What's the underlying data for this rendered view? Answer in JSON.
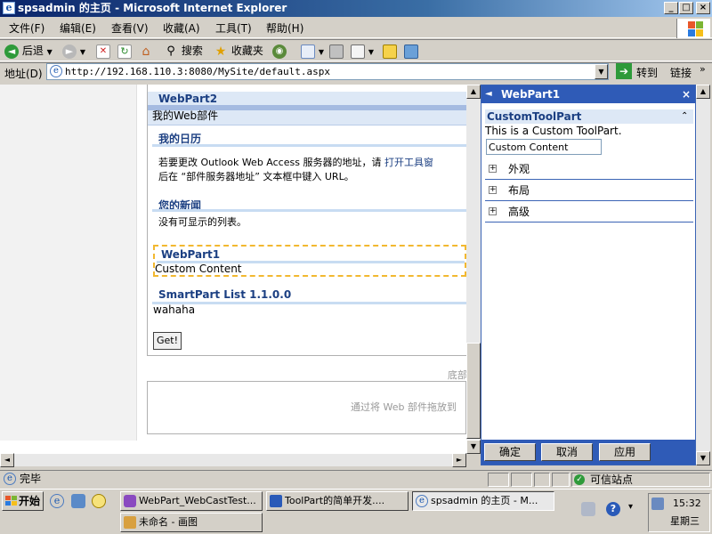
{
  "window": {
    "title": "spsadmin 的主页 - Microsoft Internet Explorer",
    "app_icon_letter": "e",
    "buttons": {
      "min": "_",
      "max": "□",
      "close": "×"
    }
  },
  "menu": [
    "文件(F)",
    "编辑(E)",
    "查看(V)",
    "收藏(A)",
    "工具(T)",
    "帮助(H)"
  ],
  "toolbar": {
    "back": "后退",
    "search": "搜索",
    "favorites": "收藏夹"
  },
  "address": {
    "label": "地址(D)",
    "url": "http://192.168.110.3:8080/MySite/default.aspx",
    "go": "转到",
    "links": "链接"
  },
  "page": {
    "webpart2_title": "WebPart2",
    "webpart2_body": "我的Web部件",
    "diary_title": "我的日历",
    "diary_line1": "若要更改 Outlook Web Access 服务器的地址，请",
    "diary_link": "打开工具窗",
    "diary_line2": "后在 “部件服务器地址” 文本框中键入 URL。",
    "news_title": "您的新闻",
    "news_body": "没有可显示的列表。",
    "webpart1_title": "WebPart1",
    "webpart1_body": "Custom Content",
    "smartpart_title": "SmartPart List 1.1.0.0",
    "smartpart_body": "wahaha",
    "get_button": "Get!",
    "bottom_zone_label": "底部",
    "drop_hint": "通过将 Web 部件拖放到"
  },
  "toolpane": {
    "title": "WebPart1",
    "close": "×",
    "back_arrow": "◄",
    "custom_title": "CustomToolPart",
    "custom_desc": "This is a Custom ToolPart.",
    "custom_value": "Custom Content",
    "sections": [
      "外观",
      "布局",
      "高级"
    ],
    "ok": "确定",
    "cancel": "取消",
    "apply": "应用"
  },
  "status": {
    "text": "完毕",
    "zone": "可信站点"
  },
  "taskbar": {
    "start": "开始",
    "tasks": [
      "WebPart_WebCastTest...",
      "ToolPart的简单开发....",
      "spsadmin 的主页 - M...",
      "未命名 - 画图"
    ],
    "time": "15:32",
    "day": "星期三"
  },
  "colors": {
    "titlebar": "#0a246a",
    "toolpane_header": "#2f5bb7",
    "webpart_title": "#1b3f82"
  }
}
